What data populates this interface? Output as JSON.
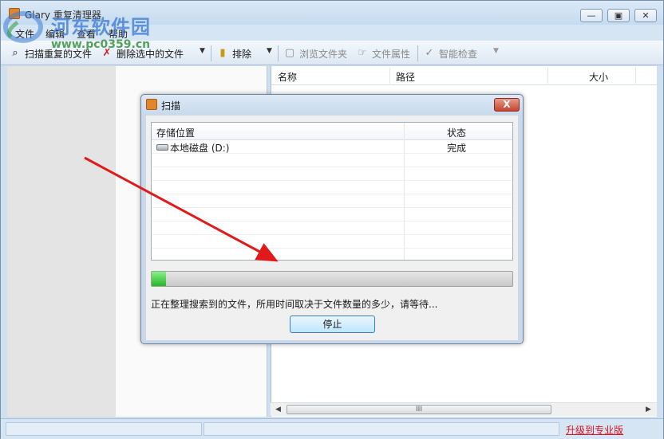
{
  "window": {
    "title": "Glary 重复清理器"
  },
  "watermark": {
    "text": "河东软件园",
    "url": "www.pc0359.cn"
  },
  "menu": [
    "文件",
    "编辑",
    "查看",
    "帮助"
  ],
  "toolbar": {
    "scan": "扫描重复的文件",
    "delete_selected": "删除选中的文件",
    "exclude": "排除",
    "browse_folder": "浏览文件夹",
    "file_properties": "文件属性",
    "smart_check": "智能检查"
  },
  "results": {
    "columns": [
      "名称",
      "路径",
      "大小"
    ]
  },
  "scrollbar": {
    "thumb_glyph": "III"
  },
  "status": {
    "upgrade": "升级到专业版"
  },
  "dialog": {
    "title": "扫描",
    "close_label": "X",
    "columns": [
      "存储位置",
      "状态"
    ],
    "rows": [
      {
        "location": "本地磁盘 (D:)",
        "status": "完成"
      }
    ],
    "progress_percent": 4,
    "message": "正在整理搜索到的文件，所用时间取决于文件数量的多少，请等待...",
    "stop": "停止"
  },
  "colors": {
    "accent": "#2a7fd4",
    "progress": "#26b626",
    "upgrade_link": "#d4141e",
    "annotation_arrow": "#e1191b"
  }
}
